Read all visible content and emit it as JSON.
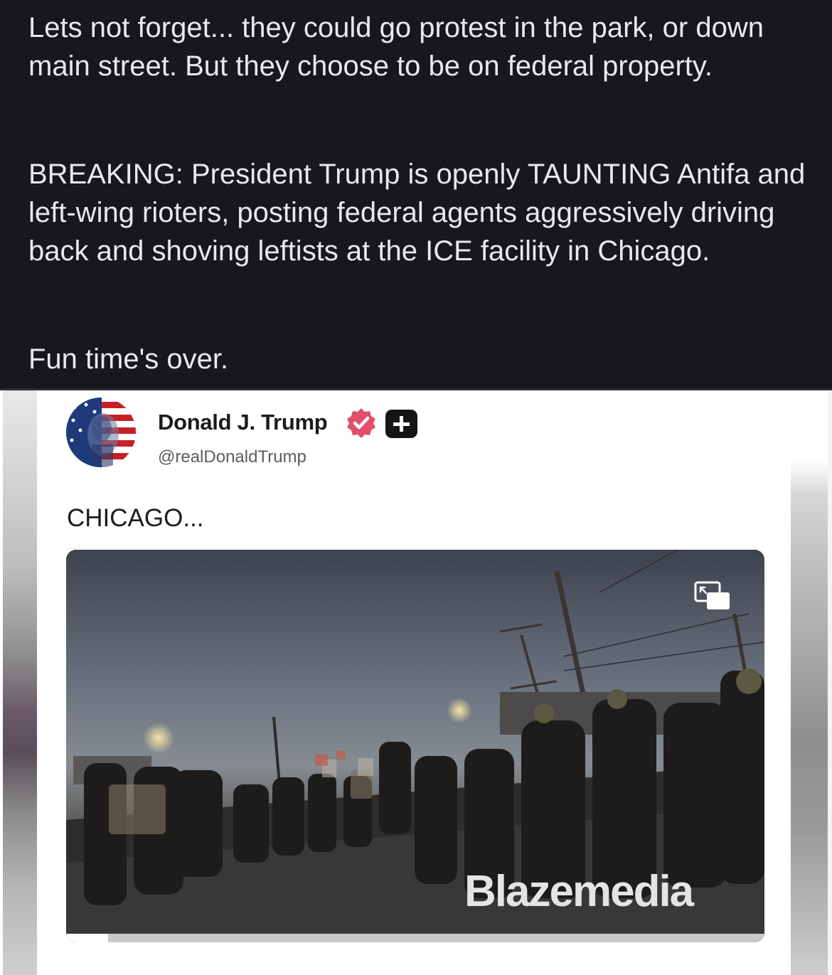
{
  "post": {
    "paragraph_1": "Lets not forget... they could go protest in the park, or down main street. But they choose to be on federal property.",
    "paragraph_2": "BREAKING: President Trump is openly TAUNTING Antifa and left-wing rioters, posting federal agents aggressively driving back and shoving leftists at the ICE facility in Chicago.",
    "paragraph_3": "Fun time's over."
  },
  "embedded_post": {
    "author_name": "Donald J. Trump",
    "author_handle": "@realDonaldTrump",
    "text": "CHICAGO...",
    "video": {
      "watermark_prefix": "Blaze",
      "watermark_suffix": "media",
      "progress_fraction": 0.06
    }
  },
  "icons": {
    "verified": "verified-badge-icon",
    "plus": "plus-badge-icon",
    "pip": "picture-in-picture-icon"
  },
  "colors": {
    "background": "#16181d",
    "text": "#e7e9ea",
    "verified_badge": "#e24f6b"
  }
}
